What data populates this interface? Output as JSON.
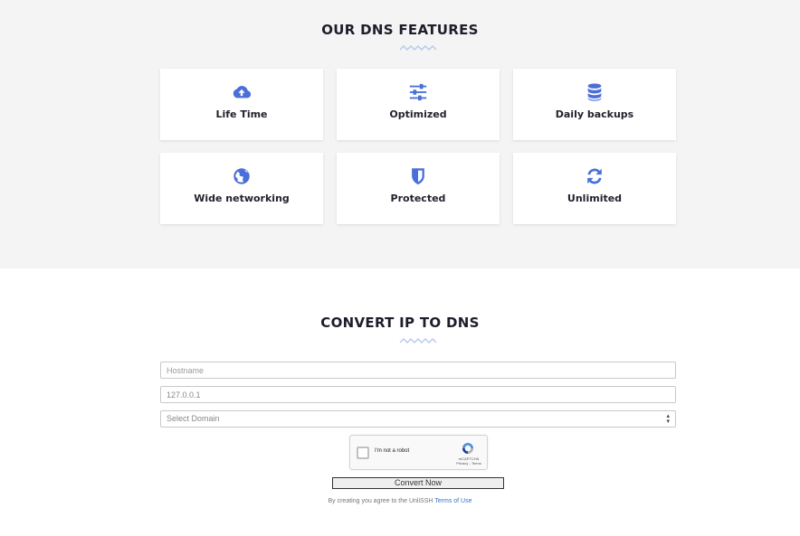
{
  "features": {
    "title": "OUR DNS FEATURES",
    "items": [
      {
        "label": "Life Time",
        "icon": "cloud-upload-icon"
      },
      {
        "label": "Optimized",
        "icon": "sliders-icon"
      },
      {
        "label": "Daily backups",
        "icon": "database-icon"
      },
      {
        "label": "Wide networking",
        "icon": "globe-icon"
      },
      {
        "label": "Protected",
        "icon": "shield-icon"
      },
      {
        "label": "Unlimited",
        "icon": "refresh-icon"
      }
    ]
  },
  "convert": {
    "title": "CONVERT IP TO DNS",
    "hostname_placeholder": "Hostname",
    "ip_value": "127.0.0.1",
    "domain_select": "Select Domain",
    "captcha_label": "I'm not a robot",
    "captcha_brand": "reCAPTCHA",
    "captcha_links": "Privacy - Terms",
    "button_label": "Convert Now",
    "terms_prefix": "By creating you agree to the UnliSSH ",
    "terms_link": "Terms of Use"
  },
  "colors": {
    "icon": "#4a6fd8",
    "wave": "#b8c8ec",
    "section_bg": "#f4f4f4"
  }
}
